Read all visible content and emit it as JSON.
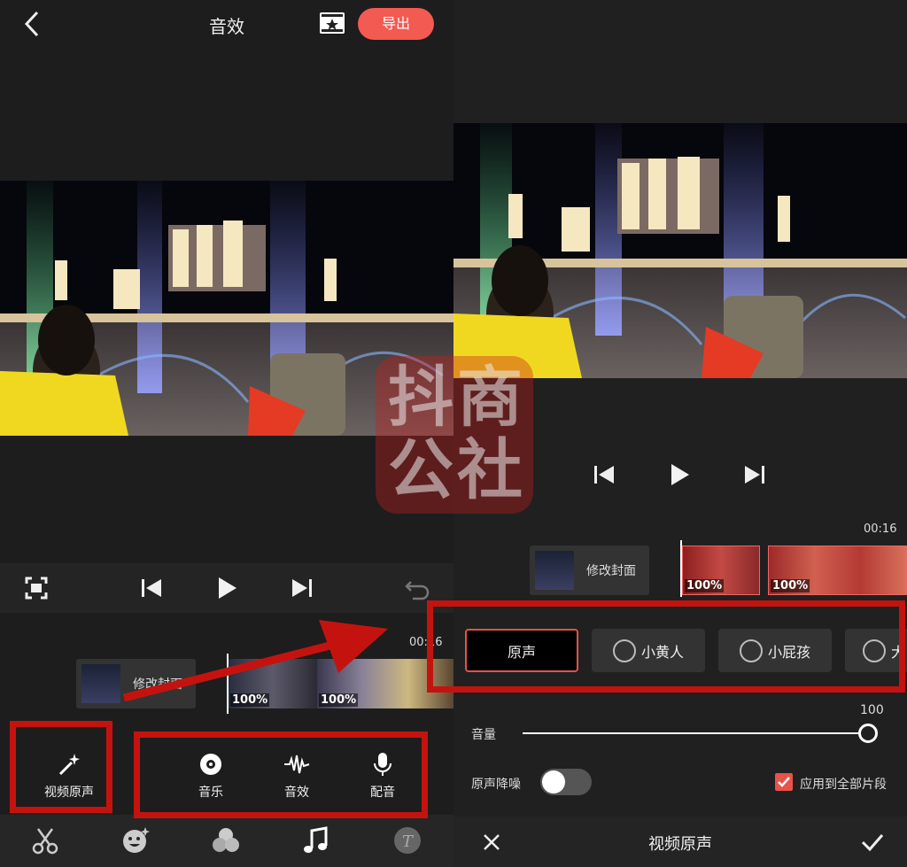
{
  "left": {
    "header": {
      "title": "音效",
      "export_label": "导出"
    },
    "timeline": {
      "time": "00:16",
      "cover_label": "修改封面",
      "clip_pct": [
        "100%",
        "100%"
      ]
    },
    "tools": {
      "video_sound": "视频原声",
      "music": "音乐",
      "effects": "音效",
      "dubbing": "配音"
    }
  },
  "right": {
    "timeline": {
      "time": "00:16",
      "cover_label": "修改封面",
      "clip_pct": [
        "100%",
        "100%"
      ]
    },
    "voices": [
      "原声",
      "小黄人",
      "小屁孩",
      "大"
    ],
    "selected_voice": "原声",
    "volume": {
      "label": "音量",
      "value": "100"
    },
    "denoise": {
      "label": "原声降噪",
      "enabled": false
    },
    "apply_all": {
      "label": "应用到全部片段",
      "checked": true
    },
    "footer_title": "视频原声"
  },
  "watermark": [
    "抖",
    "商",
    "公",
    "社"
  ],
  "colors": {
    "accent": "#f25a52",
    "highlight_box": "#c4130f",
    "background": "#1d1d1d"
  },
  "icons": [
    "back-arrow-icon",
    "film-star-icon",
    "fullscreen-icon",
    "skip-start-icon",
    "play-icon",
    "skip-end-icon",
    "undo-icon",
    "magic-wand-icon",
    "disc-icon",
    "waveform-icon",
    "microphone-icon",
    "scissors-icon",
    "sticker-face-icon",
    "filters-icon",
    "music-note-icon",
    "text-icon",
    "close-icon",
    "check-icon"
  ]
}
